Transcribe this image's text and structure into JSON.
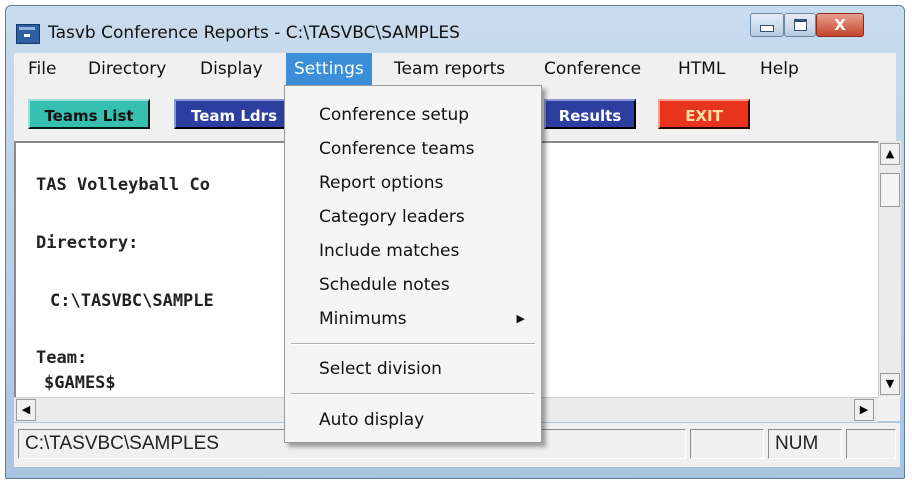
{
  "window": {
    "title": "Tasvb Conference Reports - C:\\TASVBC\\SAMPLES",
    "close_glyph": "X"
  },
  "menubar": [
    "File",
    "Directory",
    "Display",
    "Settings",
    "Team reports",
    "Conference",
    "HTML",
    "Help"
  ],
  "toolbar": {
    "teams_list": "Teams List",
    "team_ldrs": "Team Ldrs",
    "results": "Results",
    "exit": "EXIT"
  },
  "content": {
    "lines": [
      "TAS Volleyball Co",
      "Directory:",
      "C:\\TASVBC\\SAMPLE",
      "Team:",
      "$GAMES$"
    ]
  },
  "settings_menu": {
    "items": [
      "Conference setup",
      "Conference teams",
      "Report options",
      "Category leaders",
      "Include matches",
      "Schedule notes",
      "Minimums",
      "Select division",
      "Auto display"
    ],
    "submenu_arrow": "▶"
  },
  "statusbar": {
    "path": "C:\\TASVBC\\SAMPLES",
    "num": "NUM"
  },
  "colors": {
    "menu_highlight": "#3a8fd8",
    "teams_btn": "#36c0b0",
    "blue_btn": "#2c3fa0",
    "exit_btn": "#e8341c"
  },
  "icons": {
    "scroll_up": "▲",
    "scroll_down": "▼",
    "scroll_left": "◀",
    "scroll_right": "▶"
  }
}
